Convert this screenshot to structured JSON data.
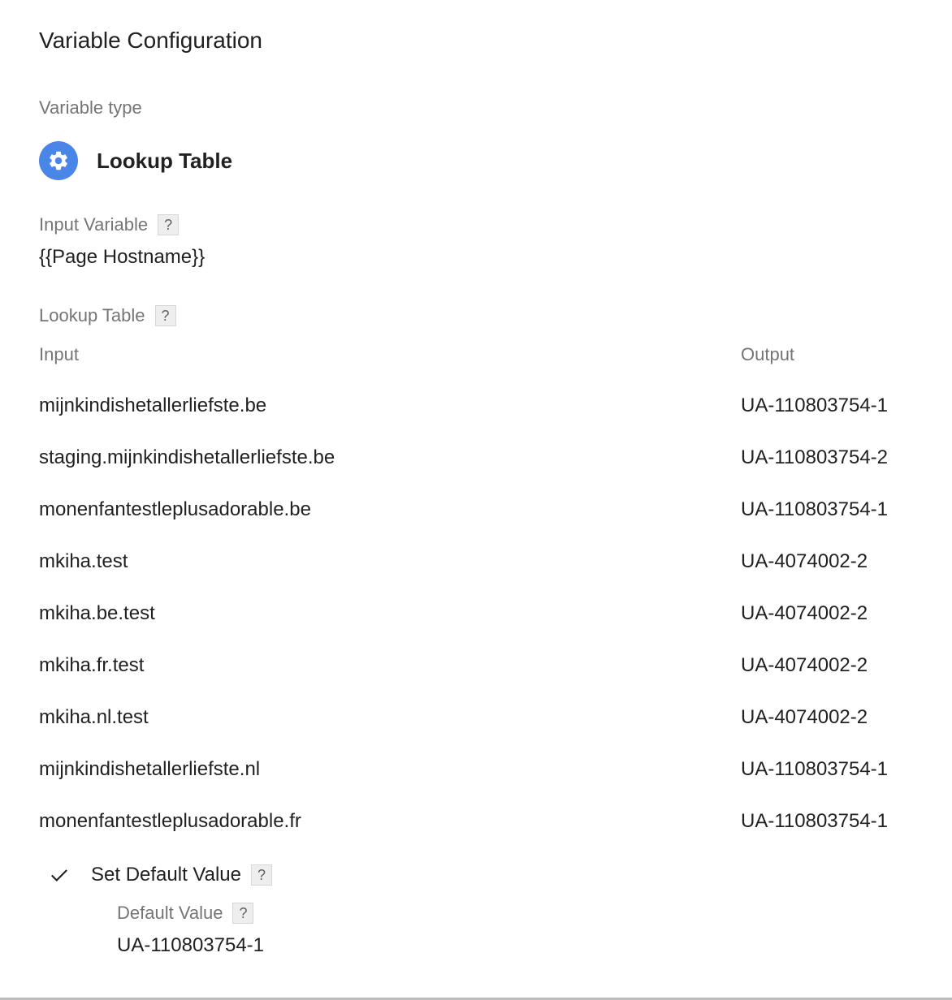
{
  "title": "Variable Configuration",
  "variable_type": {
    "label": "Variable type",
    "name": "Lookup Table",
    "icon": "gear-icon",
    "icon_color": "#4a86e8"
  },
  "input_variable": {
    "label": "Input Variable",
    "help": "?",
    "value": "{{Page Hostname}}"
  },
  "lookup_table": {
    "label": "Lookup Table",
    "help": "?",
    "columns": {
      "input": "Input",
      "output": "Output"
    },
    "rows": [
      {
        "input": "mijnkindishetallerliefste.be",
        "output": "UA-110803754-1"
      },
      {
        "input": "staging.mijnkindishetallerliefste.be",
        "output": "UA-110803754-2"
      },
      {
        "input": "monenfantestleplusadorable.be",
        "output": "UA-110803754-1"
      },
      {
        "input": "mkiha.test",
        "output": "UA-4074002-2"
      },
      {
        "input": "mkiha.be.test",
        "output": "UA-4074002-2"
      },
      {
        "input": "mkiha.fr.test",
        "output": "UA-4074002-2"
      },
      {
        "input": "mkiha.nl.test",
        "output": "UA-4074002-2"
      },
      {
        "input": "mijnkindishetallerliefste.nl",
        "output": "UA-110803754-1"
      },
      {
        "input": "monenfantestleplusadorable.fr",
        "output": "UA-110803754-1"
      }
    ]
  },
  "default_value": {
    "checkbox_label": "Set Default Value",
    "checked": true,
    "help": "?",
    "label": "Default Value",
    "value": "UA-110803754-1"
  }
}
